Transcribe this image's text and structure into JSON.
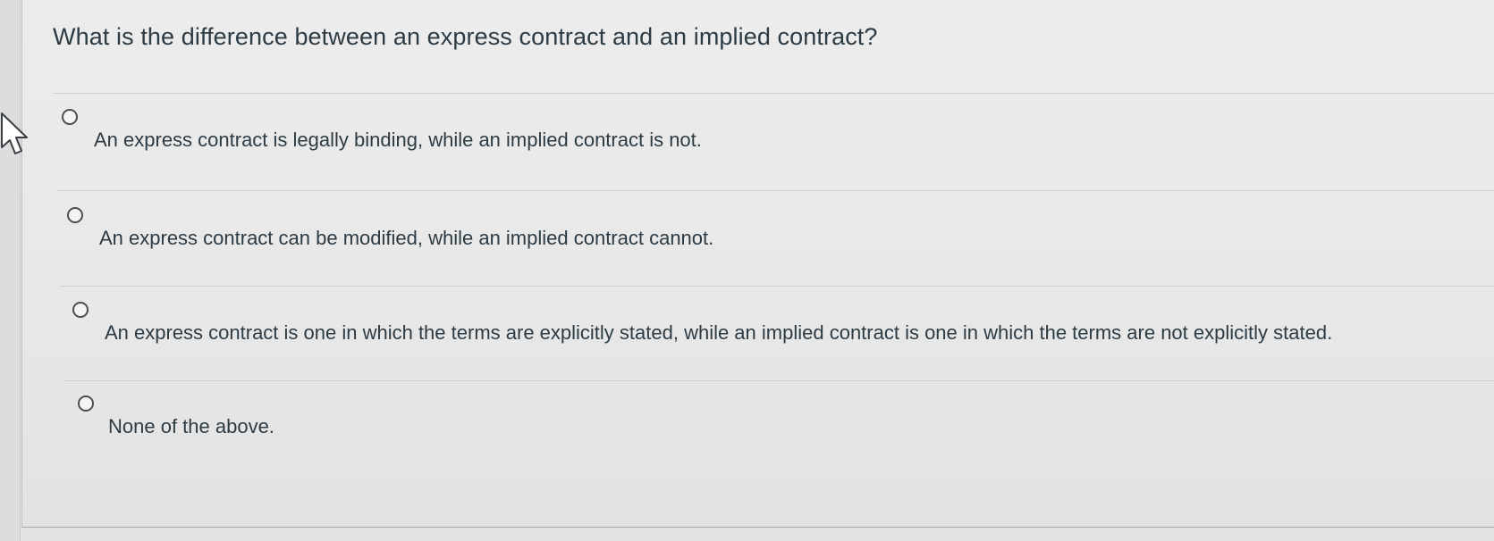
{
  "question": {
    "text": "What is the difference between an express contract and an implied contract?"
  },
  "answers": [
    {
      "label": "An express contract is legally binding, while an implied contract is not."
    },
    {
      "label": "An express contract can be modified, while an implied contract cannot."
    },
    {
      "label": "An express contract is one in which the terms are explicitly stated, while an implied contract is one in which the terms are not explicitly stated."
    },
    {
      "label": "None of the above."
    }
  ],
  "icons": {
    "cursor": "mouse-pointer-icon",
    "radio": "radio-unselected-icon"
  },
  "colors": {
    "text": "#2d3b45",
    "background": "#e8e8e8",
    "divider": "#cfcfcf"
  }
}
